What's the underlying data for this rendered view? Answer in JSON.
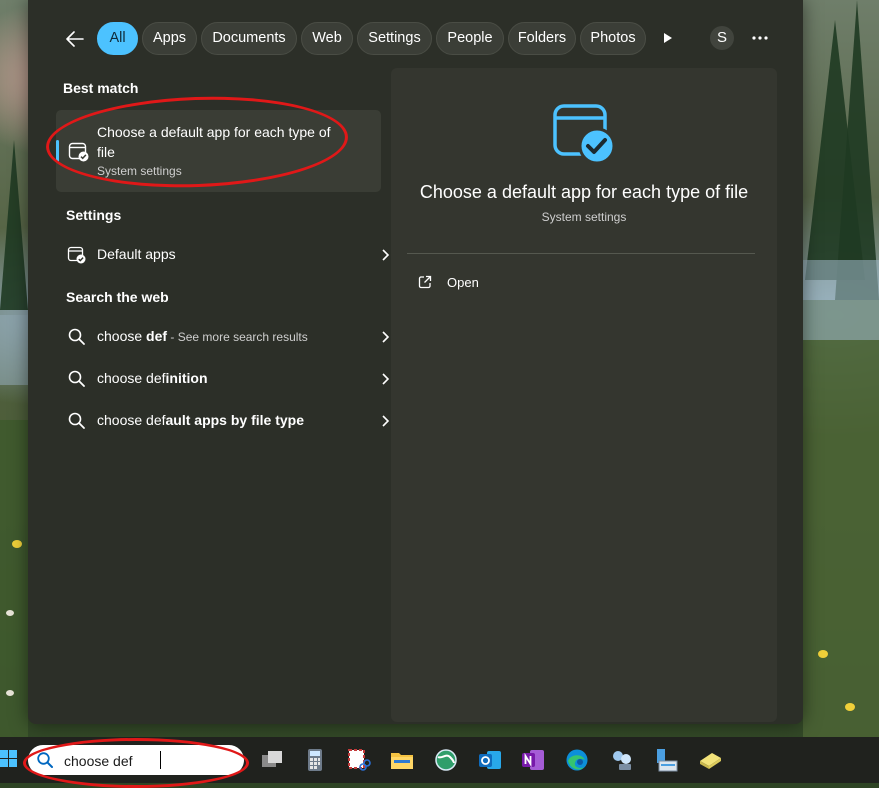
{
  "filters": {
    "back_icon": "arrow-left-icon",
    "chips": [
      {
        "label": "All",
        "active": true
      },
      {
        "label": "Apps",
        "active": false
      },
      {
        "label": "Documents",
        "active": false
      },
      {
        "label": "Web",
        "active": false
      },
      {
        "label": "Settings",
        "active": false
      },
      {
        "label": "People",
        "active": false
      },
      {
        "label": "Folders",
        "active": false
      },
      {
        "label": "Photos",
        "active": false
      }
    ],
    "more_icon": "play-icon",
    "avatar_letter": "S",
    "overflow_icon": "ellipsis-icon"
  },
  "results": {
    "best_match_heading": "Best match",
    "best_match": {
      "title": "Choose a default app for each type of file",
      "subtitle": "System settings",
      "icon": "default-apps-icon"
    },
    "settings_heading": "Settings",
    "settings_items": [
      {
        "label": "Default apps",
        "icon": "default-apps-icon"
      }
    ],
    "web_heading": "Search the web",
    "web_items": [
      {
        "prefix": "choose ",
        "bold": "def",
        "suffix": "",
        "hint": " - See more search results"
      },
      {
        "prefix": "choose ",
        "bold": "def",
        "suffix": "inition",
        "hint": ""
      },
      {
        "prefix": "choose ",
        "bold": "def",
        "suffix": "ault apps by file type",
        "hint": ""
      }
    ]
  },
  "detail": {
    "title": "Choose a default app for each type of file",
    "subtitle": "System settings",
    "actions": [
      {
        "label": "Open",
        "icon": "open-external-icon"
      }
    ]
  },
  "taskbar": {
    "search_value": "choose def",
    "apps": [
      "task-view-icon",
      "calculator-icon",
      "snipping-tool-icon",
      "file-explorer-icon",
      "browser-globe-icon",
      "outlook-icon",
      "onenote-icon",
      "edge-icon",
      "network-tool-icon",
      "remote-desktop-icon",
      "notepad-icon"
    ]
  },
  "colors": {
    "accent": "#4cc2ff",
    "panel": "#2c2f28",
    "annotation": "#e01818"
  }
}
